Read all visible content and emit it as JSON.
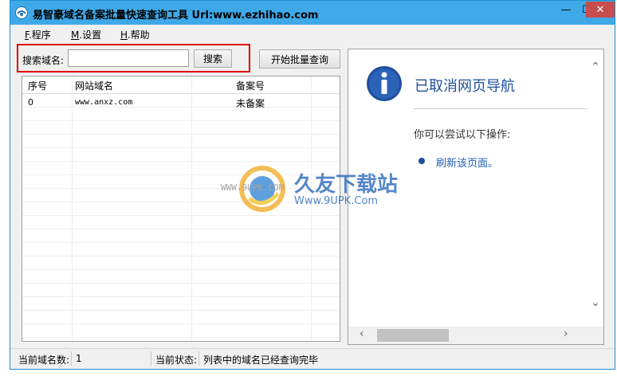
{
  "window": {
    "title": "易智豪域名备案批量快速查询工具 Url:www.ezhihao.com",
    "min_label": "—",
    "max_label": "☐",
    "close_label": "✕"
  },
  "menu": {
    "items": [
      {
        "key": "F",
        "label": ".程序"
      },
      {
        "key": "M",
        "label": ".设置"
      },
      {
        "key": "H",
        "label": ".帮助"
      }
    ]
  },
  "search": {
    "label": "搜索域名:",
    "value": "",
    "button": "搜索"
  },
  "batch_button": "开始批量查询",
  "table": {
    "columns": [
      "序号",
      "网站域名",
      "备案号"
    ],
    "rows": [
      {
        "index": "0",
        "domain": "www.anxz.com",
        "record": "未备案"
      }
    ]
  },
  "browser": {
    "title": "已取消网页导航",
    "subtitle": "你可以尝试以下操作:",
    "link": "刷新该页面。"
  },
  "status": {
    "count_label": "当前域名数:",
    "count_value": "1",
    "state_label": "当前状态:",
    "state_value": "列表中的域名已经查询完毕"
  },
  "watermark": {
    "brand": "久友下载站",
    "url": "Www.9UPK.Com",
    "url2": "WWW.9UPK.COM"
  },
  "colors": {
    "titlebar": "#3fa9e8",
    "close": "#c74d4d",
    "highlight": "#e00000",
    "link": "#1f5fb5"
  }
}
